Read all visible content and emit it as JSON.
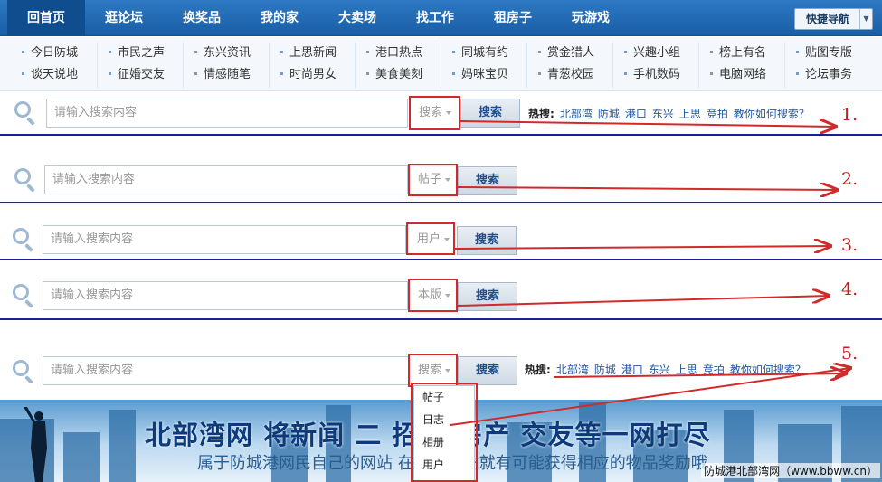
{
  "nav": {
    "items": [
      "回首页",
      "逛论坛",
      "换奖品",
      "我的家",
      "大卖场",
      "找工作",
      "租房子",
      "玩游戏"
    ],
    "quick_nav": "快捷导航"
  },
  "subnav": {
    "columns": [
      [
        "今日防城",
        "谈天说地"
      ],
      [
        "市民之声",
        "征婚交友"
      ],
      [
        "东兴资讯",
        "情感随笔"
      ],
      [
        "上思新闻",
        "时尚男女"
      ],
      [
        "港口热点",
        "美食美刻"
      ],
      [
        "同城有约",
        "妈咪宝贝"
      ],
      [
        "赏金猎人",
        "青葱校园"
      ],
      [
        "兴趣小组",
        "手机数码"
      ],
      [
        "榜上有名",
        "电脑网络"
      ],
      [
        "贴图专版",
        "论坛事务"
      ]
    ]
  },
  "search": {
    "placeholder": "请输入搜索内容",
    "button": "搜索",
    "hot_label": "热搜:",
    "hot_keywords": [
      "北部湾",
      "防城",
      "港口",
      "东兴",
      "上思",
      "竞拍",
      "教你如何搜索？"
    ],
    "rows": [
      {
        "select": "搜索",
        "number": "1."
      },
      {
        "select": "帖子",
        "number": "2."
      },
      {
        "select": "用户",
        "number": "3."
      },
      {
        "select": "本版",
        "number": "4."
      },
      {
        "select": "搜索",
        "number": "5."
      }
    ],
    "dropdown_options": [
      "帖子",
      "日志",
      "相册",
      "用户"
    ]
  },
  "banner": {
    "headline": "北部湾网 将新闻 二   招聘 房产 交友等一网打尽",
    "subline": "属于防城港网民自己的网站    在此陆发帖就有可能获得相应的物品奖励哦",
    "watermark": "防城港北部湾网（www.bbww.cn）"
  },
  "colors": {
    "nav": "#1a5ea6",
    "annotation": "#d12a2a",
    "divider": "#1b1f9e"
  }
}
